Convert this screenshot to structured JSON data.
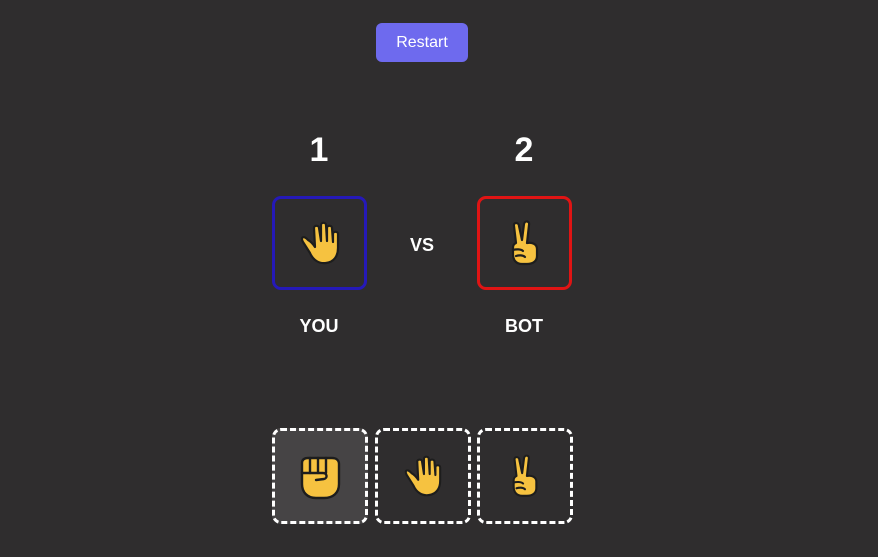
{
  "restart_label": "Restart",
  "scores": {
    "you": "1",
    "bot": "2"
  },
  "vs_label": "VS",
  "players": {
    "you": "YOU",
    "bot": "BOT"
  },
  "played": {
    "you": "paper-hand-icon",
    "bot": "scissors-hand-icon"
  },
  "choices": [
    "rock-fist-icon",
    "paper-hand-icon",
    "scissors-hand-icon"
  ],
  "selected_choice": "rock-fist-icon",
  "colors": {
    "background": "#2f2d2e",
    "restart_button": "#6e6aee",
    "you_border": "#2519b8",
    "bot_border": "#e01414",
    "selected_choice_bg": "#464445",
    "hand_fill": "#f6c240"
  }
}
